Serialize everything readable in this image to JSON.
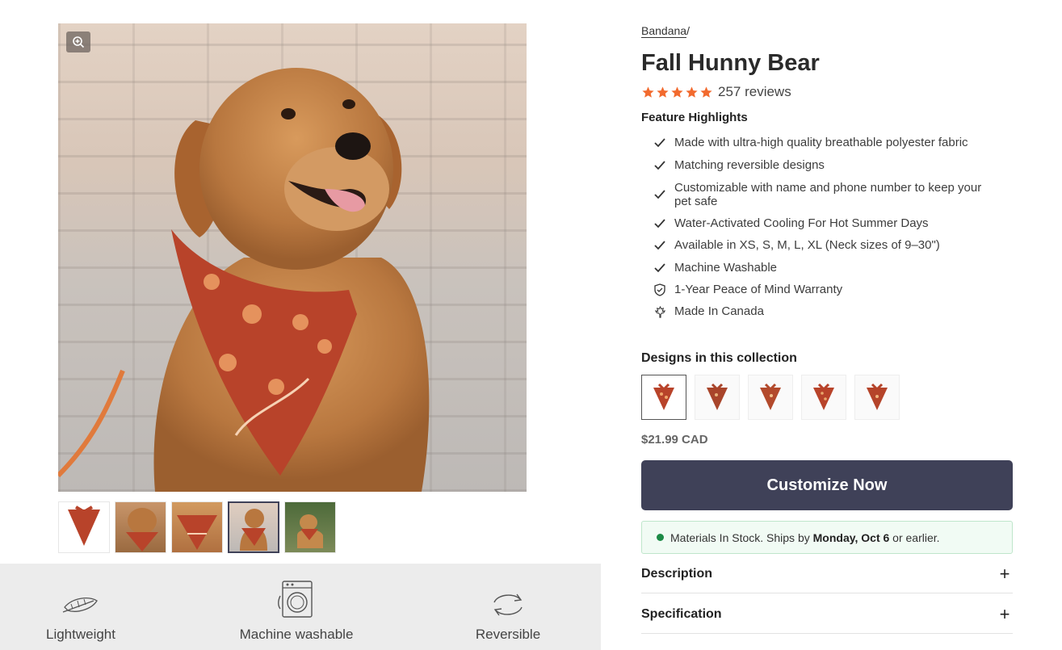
{
  "gallery": {
    "main_image_alt": "",
    "thumbnails": [
      {
        "name": "bandana-flat"
      },
      {
        "name": "dog-side"
      },
      {
        "name": "bandana-closeup"
      },
      {
        "name": "dog-front"
      },
      {
        "name": "dog-standing"
      }
    ],
    "active_thumbnail_index": 3
  },
  "features_bar": {
    "items": [
      {
        "icon": "feather-icon",
        "label": "Lightweight"
      },
      {
        "icon": "washing-machine-icon",
        "label": "Machine washable"
      },
      {
        "icon": "reverse-arrows-icon",
        "label": "Reversible"
      }
    ]
  },
  "product": {
    "breadcrumb_category": "Bandana",
    "breadcrumb_separator": "/",
    "title": "Fall Hunny Bear",
    "rating_stars": 5,
    "reviews": "257 reviews",
    "feature_highlights_title": "Feature Highlights",
    "feature_highlights": [
      {
        "icon": "check-icon",
        "text": "Made with ultra-high quality breathable polyester fabric"
      },
      {
        "icon": "check-icon",
        "text": "Matching reversible designs"
      },
      {
        "icon": "check-icon",
        "text": "Customizable with name and phone number to keep your pet safe"
      },
      {
        "icon": "check-icon",
        "text": "Water-Activated Cooling For Hot Summer Days"
      },
      {
        "icon": "check-icon",
        "text": "Available in XS, S, M, L, XL (Neck sizes of 9–30\")"
      },
      {
        "icon": "check-icon",
        "text": "Machine Washable"
      },
      {
        "icon": "shield-check-icon",
        "text": "1-Year Peace of Mind Warranty"
      },
      {
        "icon": "maple-leaf-icon",
        "text": "Made In Canada"
      }
    ],
    "collection_title": "Designs in this collection",
    "designs_count": 5,
    "active_design_index": 0,
    "price": "$21.99 CAD",
    "cta_label": "Customize Now",
    "stock": {
      "prefix": "Materials In Stock. Ships by ",
      "date": "Monday, Oct 6",
      "suffix": " or earlier."
    },
    "accordions": [
      {
        "label": "Description",
        "toggle": "+"
      },
      {
        "label": "Specification",
        "toggle": "+"
      }
    ]
  },
  "colors": {
    "accent": "#3f4158",
    "star": "#f26a2e",
    "stock_dot": "#1c8a46",
    "bandana": "#b8432a"
  }
}
